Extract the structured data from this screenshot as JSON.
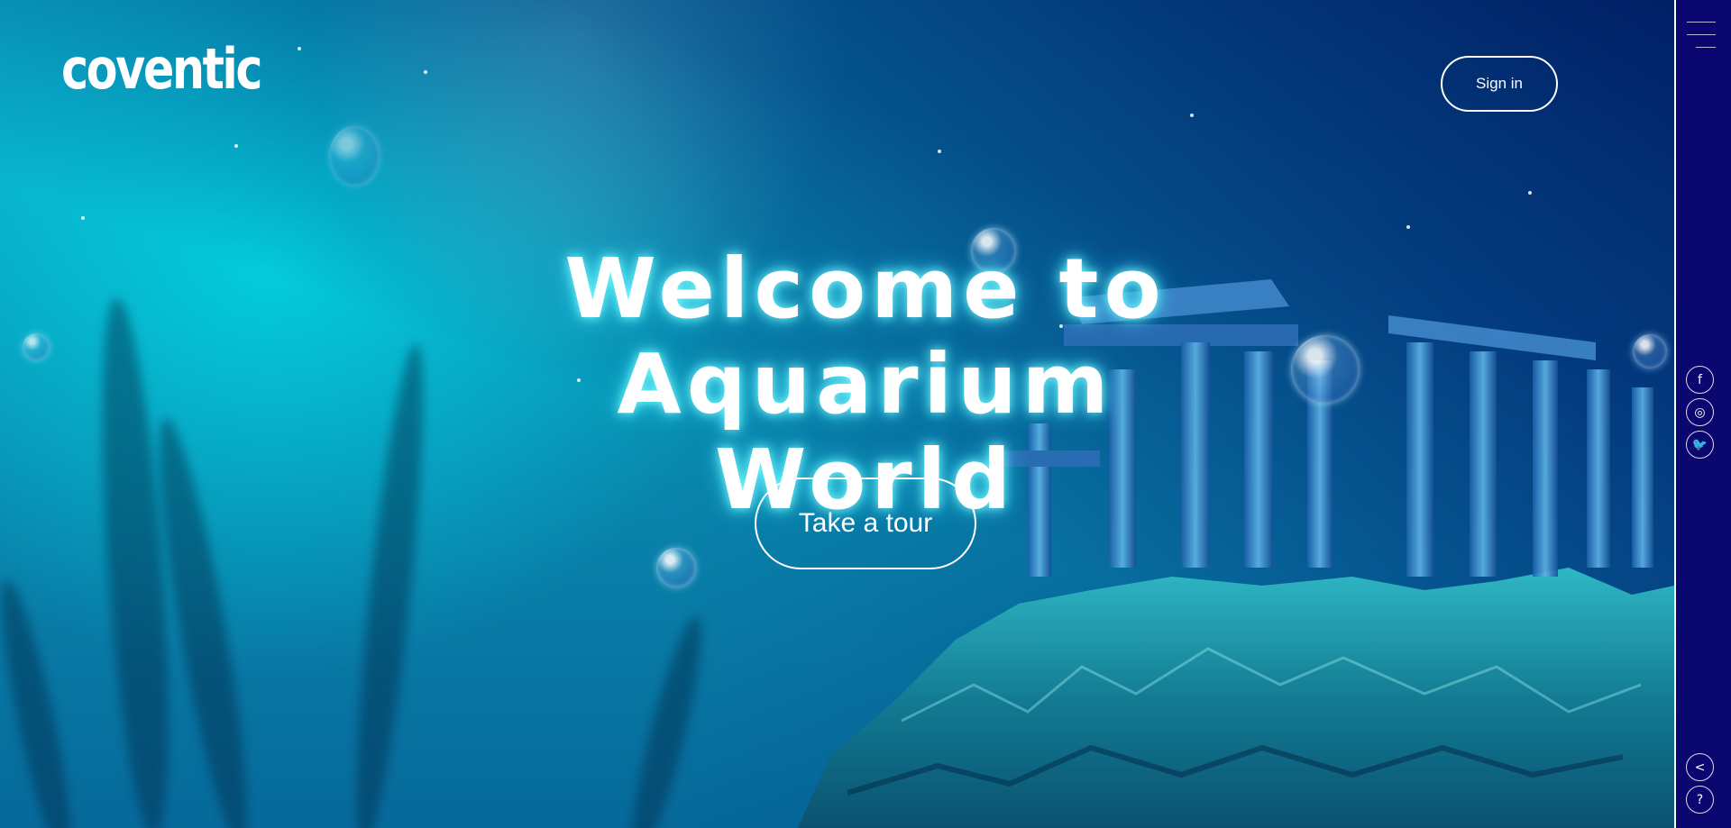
{
  "brand": {
    "logo_text": "coventic"
  },
  "header": {
    "signin_label": "Sign in"
  },
  "hero": {
    "title_line1": "Welcome to",
    "title_line2": "Aquarium World",
    "cta_label": "Take a tour"
  },
  "rail": {
    "menu_icon": "hamburger-menu-icon",
    "social": [
      {
        "name": "facebook-icon",
        "glyph": "f"
      },
      {
        "name": "instagram-icon",
        "glyph": "◎"
      },
      {
        "name": "twitter-icon",
        "glyph": "🐦"
      }
    ],
    "utility": [
      {
        "name": "share-icon",
        "glyph": "<"
      },
      {
        "name": "help-icon",
        "glyph": "?"
      }
    ]
  },
  "colors": {
    "rail_bg": "#0a0870",
    "accent_glow": "#7ff7ff",
    "water_top": "#0bb7cf",
    "water_deep": "#06699a"
  }
}
